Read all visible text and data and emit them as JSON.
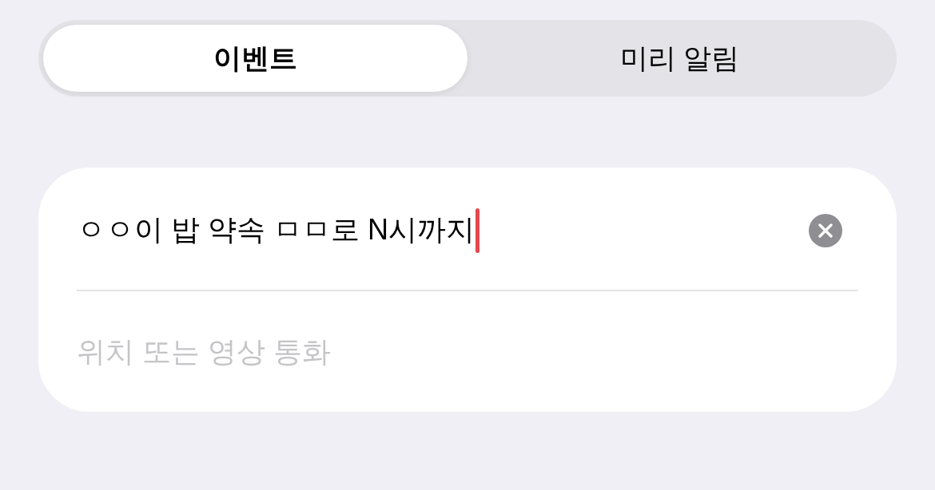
{
  "segmented_control": [
    {
      "label": "이벤트",
      "selected": true
    },
    {
      "label": "미리 알림",
      "selected": false
    }
  ],
  "form": {
    "title_field": {
      "value": "ㅇㅇ이 밥 약속 ㅁㅁ로 N시까지",
      "focused": true
    },
    "location_field": {
      "placeholder": "위치 또는 영상 통화"
    }
  }
}
